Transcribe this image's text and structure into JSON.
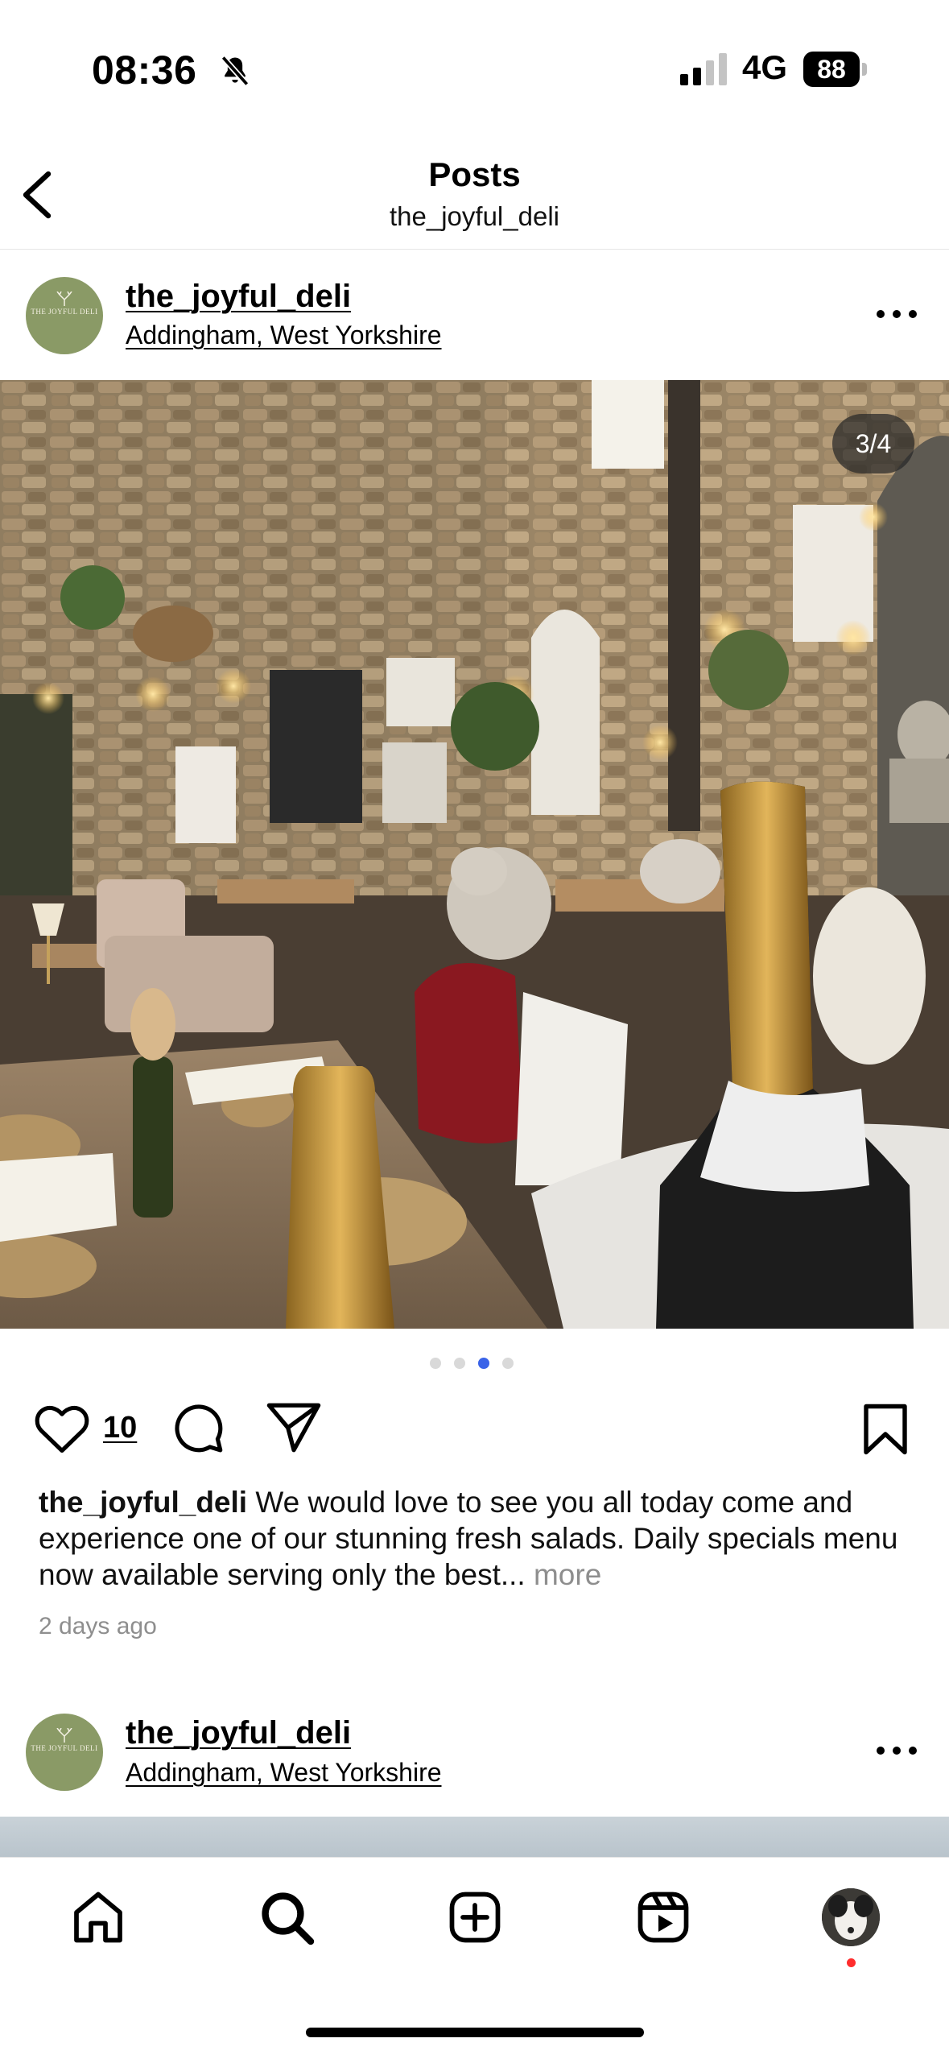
{
  "status_bar": {
    "time": "08:36",
    "network": "4G",
    "battery": "88"
  },
  "header": {
    "title": "Posts",
    "subtitle": "the_joyful_deli"
  },
  "posts": [
    {
      "username": "the_joyful_deli",
      "location": "Addingham, West Yorkshire",
      "avatar_text": "THE JOYFUL DELI",
      "image_counter": "3/4",
      "carousel": {
        "total": 4,
        "active_index": 2
      },
      "like_count": "10",
      "caption_user": "the_joyful_deli",
      "caption_text": "We would love to see you all today come and experience one of our stunning fresh salads. Daily specials menu now available serving only the best...",
      "caption_more": "more",
      "time_ago": "2 days ago"
    },
    {
      "username": "the_joyful_deli",
      "location": "Addingham, West Yorkshire",
      "avatar_text": "THE JOYFUL DELI"
    }
  ],
  "tab_bar": {
    "items": [
      "home-icon",
      "search-icon",
      "create-icon",
      "reels-icon",
      "profile"
    ]
  },
  "colors": {
    "accent_dot": "#3a63e8",
    "notification": "#ff2d2d",
    "avatar_bg": "#8a9a66"
  }
}
